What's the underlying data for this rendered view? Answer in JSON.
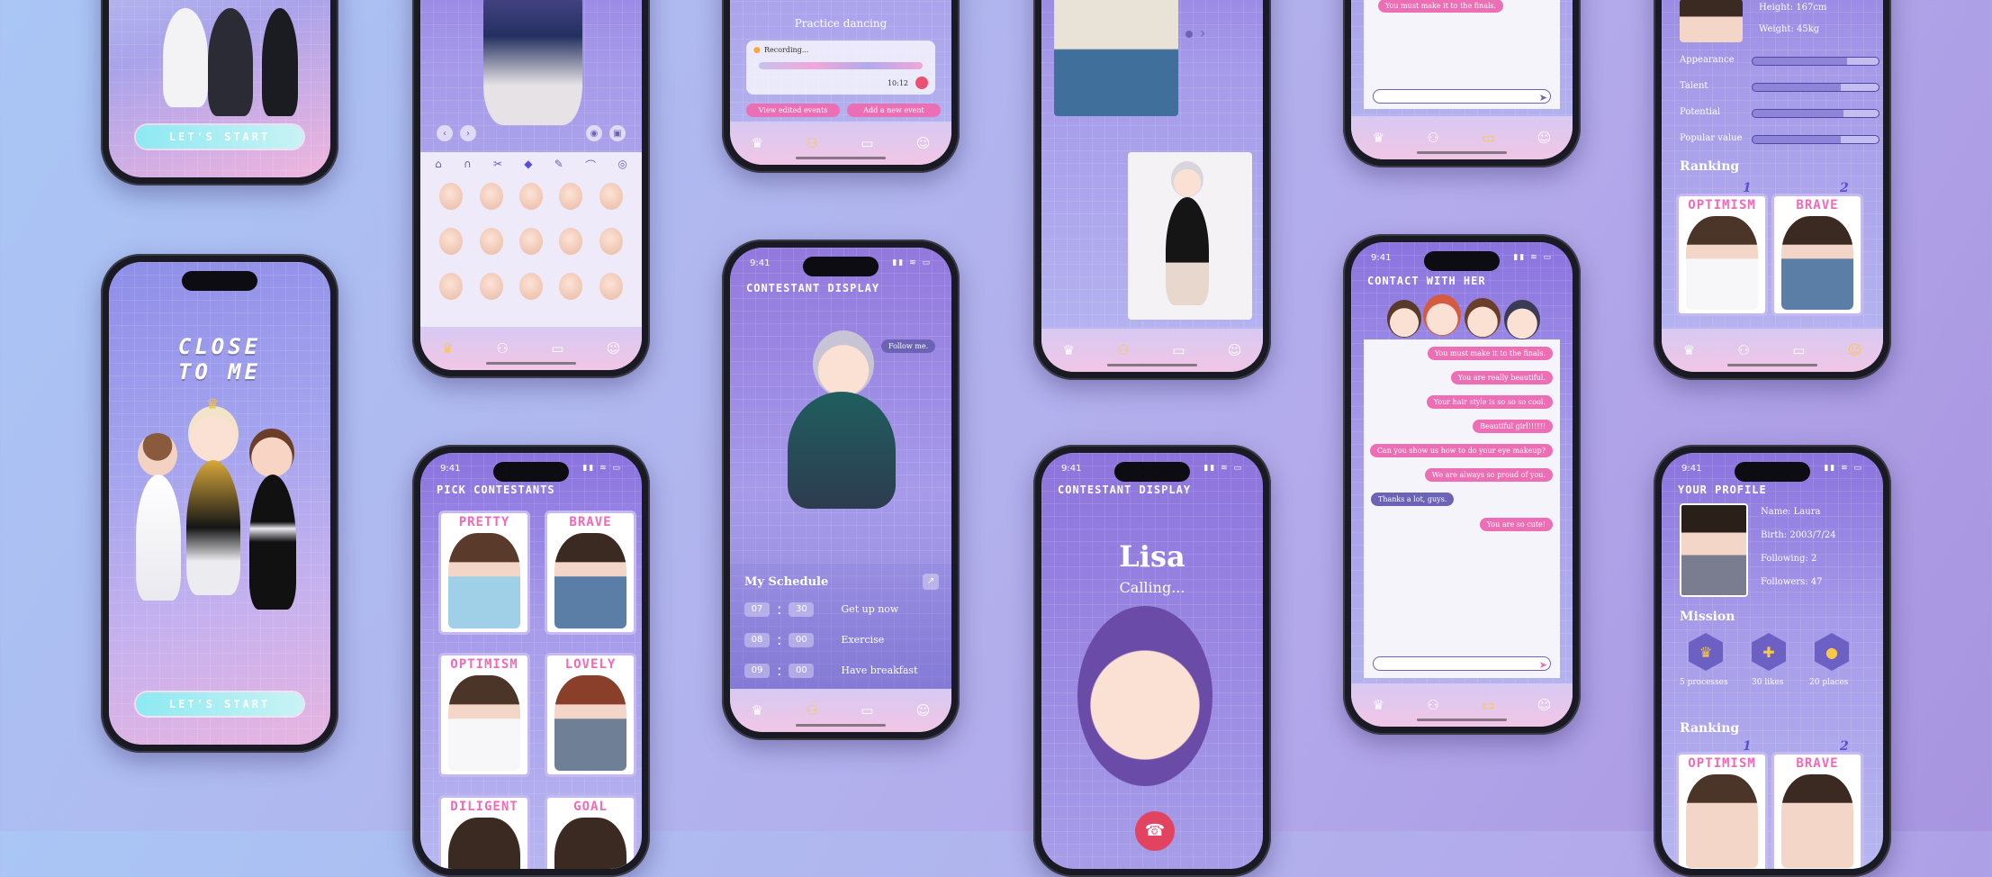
{
  "status": {
    "time": "9:41"
  },
  "intro": {
    "title_line1": "CLOSE",
    "title_line2": "TO ME",
    "start_label": "LET'S START"
  },
  "editor": {
    "tools": [
      "back-icon",
      "forward-icon",
      "eye-icon",
      "save-icon"
    ]
  },
  "schedule_small": {
    "title": "Practice dancing",
    "recording_label": "Recording...",
    "duration": "10:12",
    "view_button": "View edited events",
    "add_button": "Add a new event"
  },
  "display": {
    "header": "CONTESTANT DISPLAY",
    "follow_button": "Follow me.",
    "schedule_title": "My Schedule",
    "schedule": [
      {
        "h": "07",
        "m": "30",
        "label": "Get up now"
      },
      {
        "h": "08",
        "m": "00",
        "label": "Exercise"
      },
      {
        "h": "09",
        "m": "00",
        "label": "Have breakfast"
      }
    ]
  },
  "pick": {
    "header": "PICK CONTESTANTS",
    "cards": [
      "PRETTY",
      "BRAVE",
      "OPTIMISM",
      "LOVELY",
      "DILIGENT",
      "GOAL"
    ]
  },
  "calling": {
    "header": "CONTESTANT DISPLAY",
    "name": "Lisa",
    "status": "Calling..."
  },
  "chat_top": {
    "message": "You must make it to the finals."
  },
  "contact": {
    "header": "CONTACT WITH HER",
    "messages": [
      {
        "text": "You must make it to the finals.",
        "mine": true
      },
      {
        "text": "You are really beautiful.",
        "mine": true
      },
      {
        "text": "Your hair style is so so so cool.",
        "mine": true
      },
      {
        "text": "Beautiful girl!!!!!!",
        "mine": true
      },
      {
        "text": "Can you show us how to do your eye makeup?",
        "mine": true
      },
      {
        "text": "We are always so proud of you.",
        "mine": true
      },
      {
        "text": "Thanks a lot, guys.",
        "mine": false
      },
      {
        "text": "You are so cute!",
        "mine": true
      }
    ]
  },
  "stats": {
    "height": "Height: 167cm",
    "weight": "Weight: 45kg",
    "rows": [
      {
        "label": "Appearance",
        "value": 0.75
      },
      {
        "label": "Talent",
        "value": 0.7
      },
      {
        "label": "Potential",
        "value": 0.72
      },
      {
        "label": "Popular value",
        "value": 0.7
      }
    ],
    "ranking_title": "Ranking",
    "rank_cards": [
      "OPTIMISM",
      "BRAVE"
    ],
    "rank_nums": [
      "1",
      "2"
    ]
  },
  "profile": {
    "header": "YOUR PROFILE",
    "name": "Name: Laura",
    "birth": "Birth: 2003/7/24",
    "following": "Following: 2",
    "followers": "Followers: 47",
    "mission_title": "Mission",
    "missions": [
      {
        "label": "5 processes"
      },
      {
        "label": "30 likes"
      },
      {
        "label": "20 places"
      }
    ],
    "ranking_title": "Ranking",
    "rank_cards": [
      "OPTIMISM",
      "BRAVE"
    ],
    "rank_nums": [
      "1",
      "2"
    ]
  },
  "colors": {
    "accent_pink": "#ec6fb5",
    "accent_purple": "#6b63b5",
    "gold": "#f7c948"
  }
}
